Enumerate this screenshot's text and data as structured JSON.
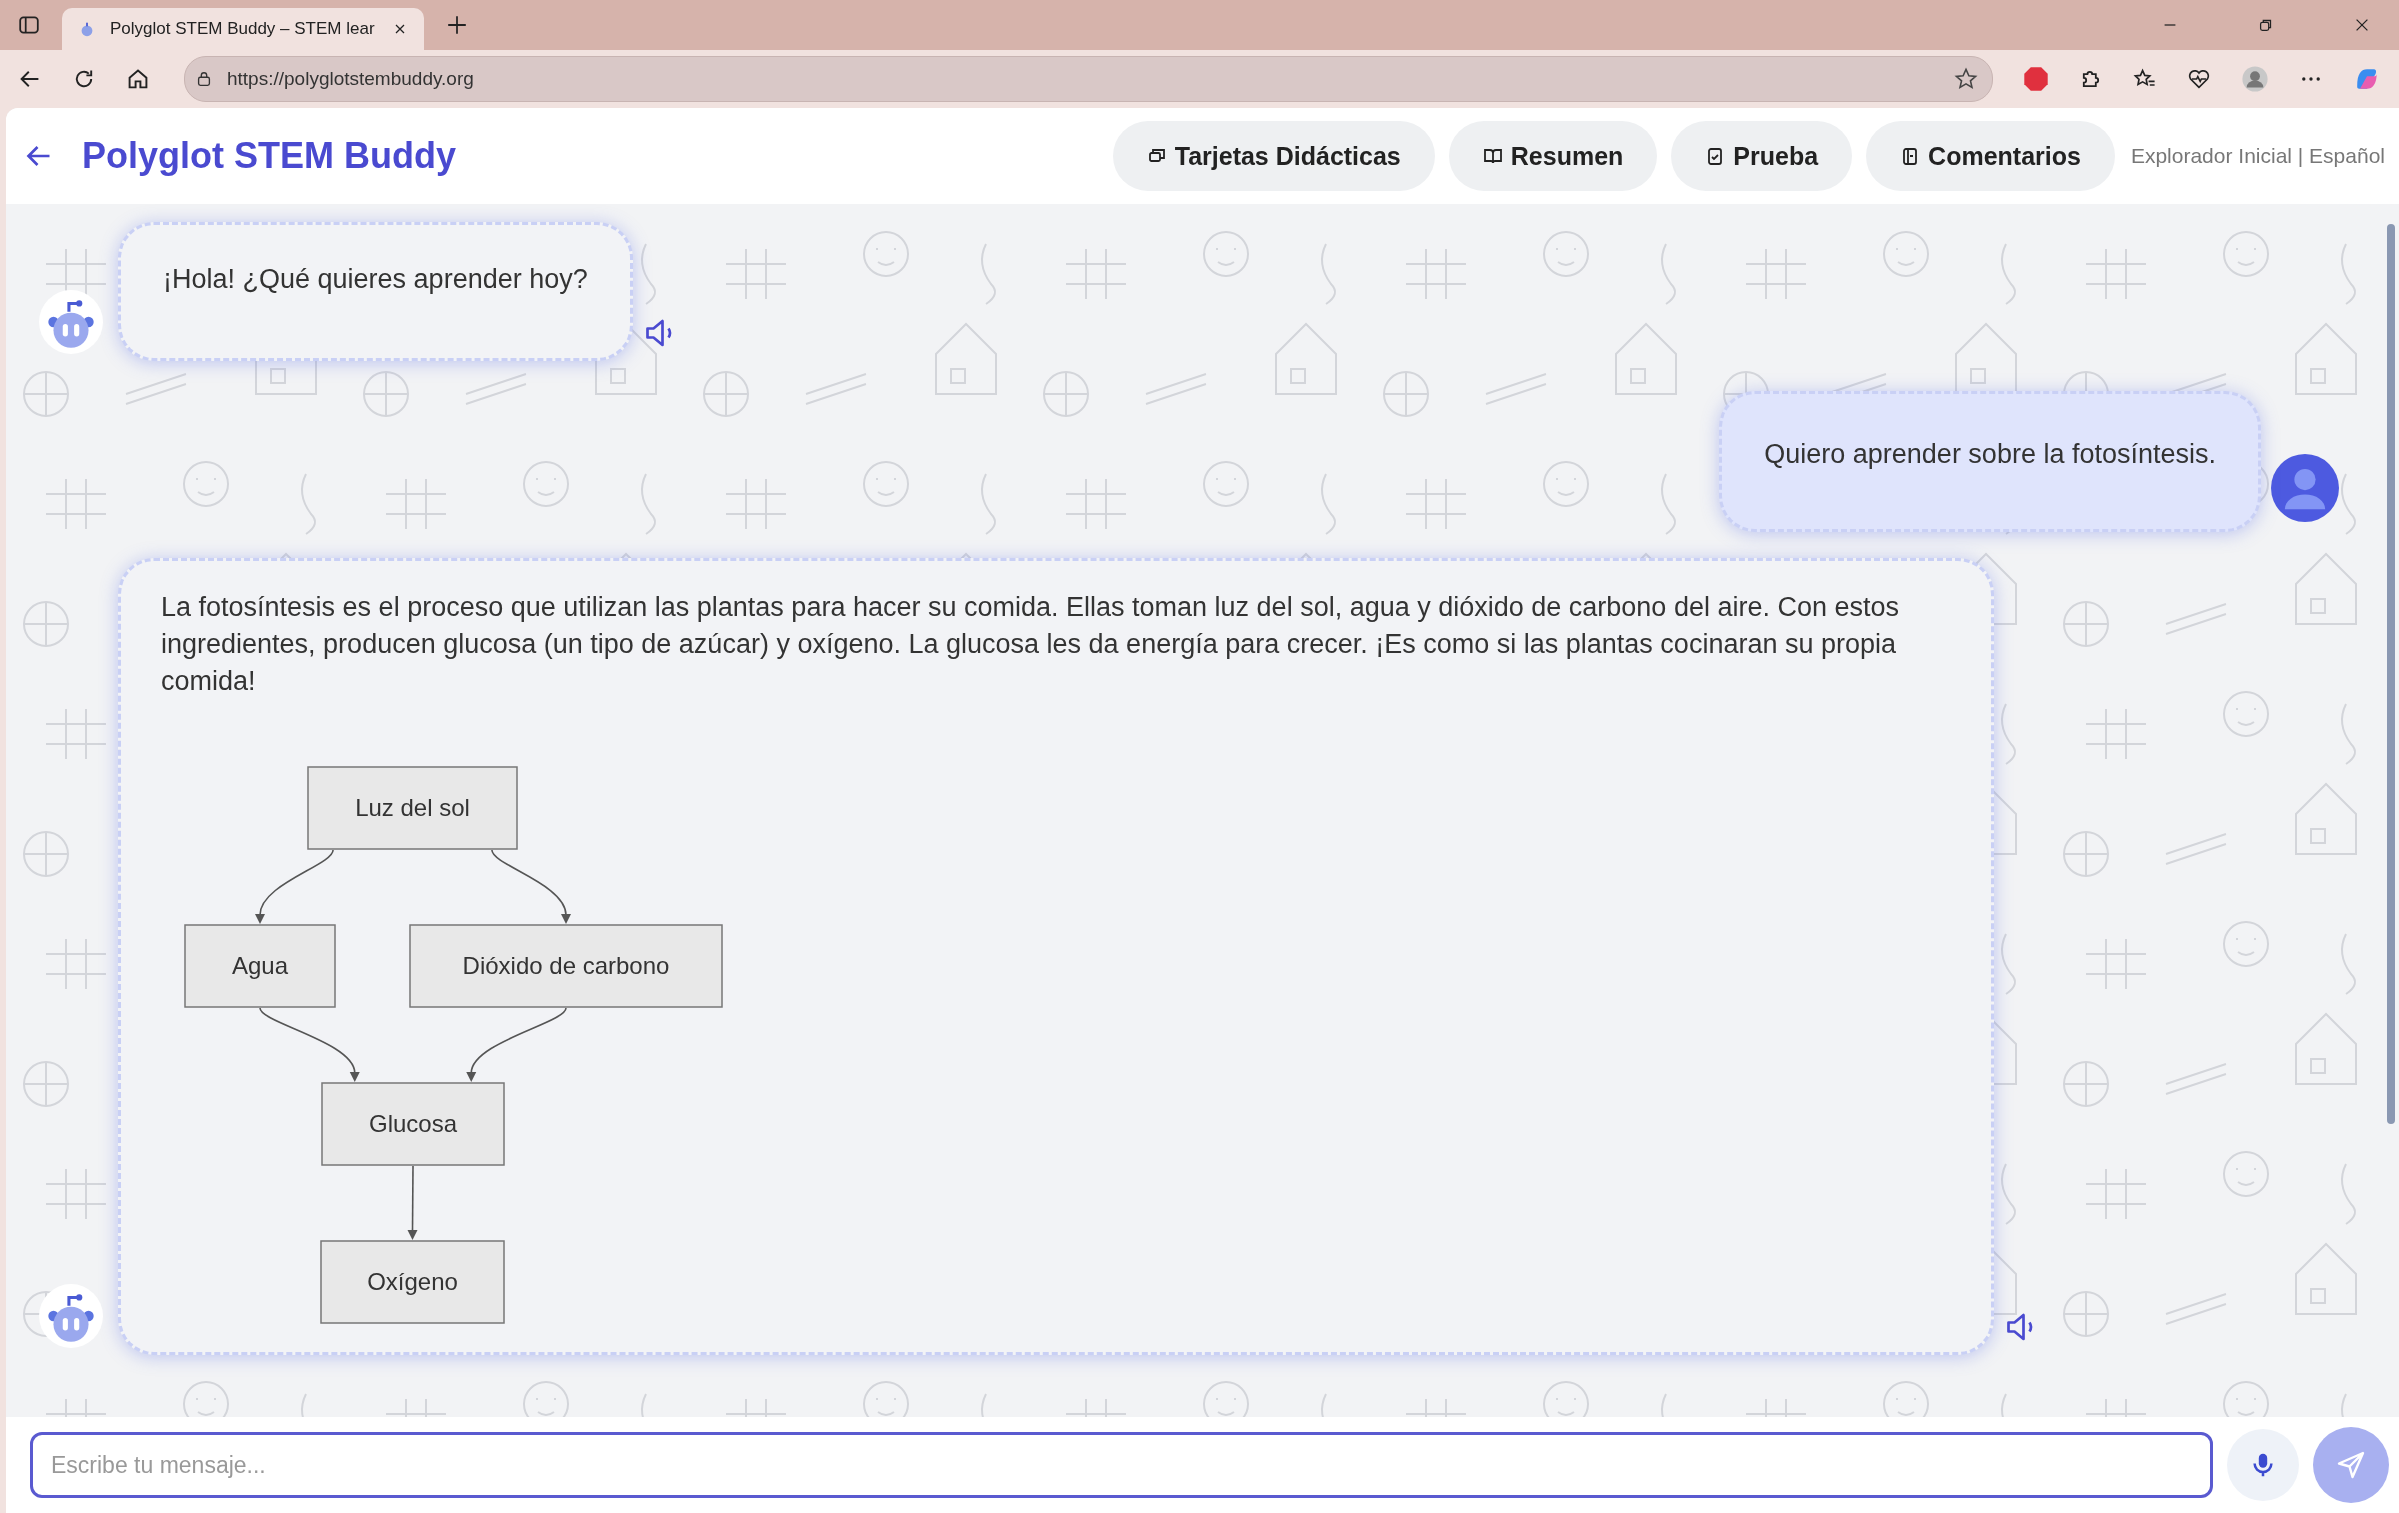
{
  "browser": {
    "tab_title": "Polyglot STEM Buddy – STEM lear",
    "url": "https://polyglotstembuddy.org"
  },
  "header": {
    "title": "Polyglot STEM Buddy",
    "nav": [
      {
        "label": "Tarjetas Didácticas"
      },
      {
        "label": "Resumen"
      },
      {
        "label": "Prueba"
      },
      {
        "label": "Comentarios"
      }
    ],
    "status": "Explorador Inicial | Español"
  },
  "messages": [
    {
      "kind": "bot",
      "text": "¡Hola! ¿Qué quieres aprender hoy?"
    },
    {
      "kind": "user",
      "text": "Quiero aprender sobre la fotosíntesis."
    },
    {
      "kind": "bot",
      "text": "La fotosíntesis es el proceso que utilizan las plantas para hacer su comida. Ellas toman luz del sol, agua y dióxido de carbono del aire. Con estos ingredientes, producen glucosa (un tipo de azúcar) y oxígeno. La glucosa les da energía para crecer. ¡Es como si las plantas cocinaran su propia comida!",
      "diagram": {
        "nodes": [
          "Luz del sol",
          "Agua",
          "Dióxido de carbono",
          "Glucosa",
          "Oxígeno"
        ]
      }
    }
  ],
  "input": {
    "placeholder": "Escribe tu mensaje..."
  }
}
